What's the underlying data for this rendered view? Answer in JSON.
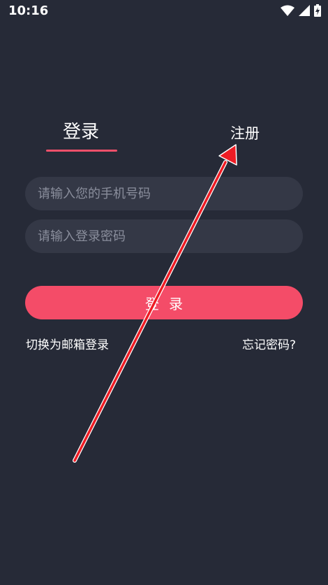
{
  "status_bar": {
    "time": "10:16",
    "icons": [
      "wifi-icon",
      "signal-icon",
      "battery-charging-icon"
    ]
  },
  "tabs": {
    "login": "登录",
    "register": "注册",
    "active": "login",
    "accent_color": "#f0506a"
  },
  "form": {
    "phone_placeholder": "请输入您的手机号码",
    "phone_value": "",
    "password_placeholder": "请输入登录密码",
    "password_value": "",
    "login_button": "登录",
    "button_color": "#f44c68"
  },
  "links": {
    "switch_to_email": "切换为邮箱登录",
    "forgot_password": "忘记密码?"
  },
  "annotation": {
    "type": "red-arrow",
    "color": "#ee1c24",
    "points_to": "register-tab"
  }
}
